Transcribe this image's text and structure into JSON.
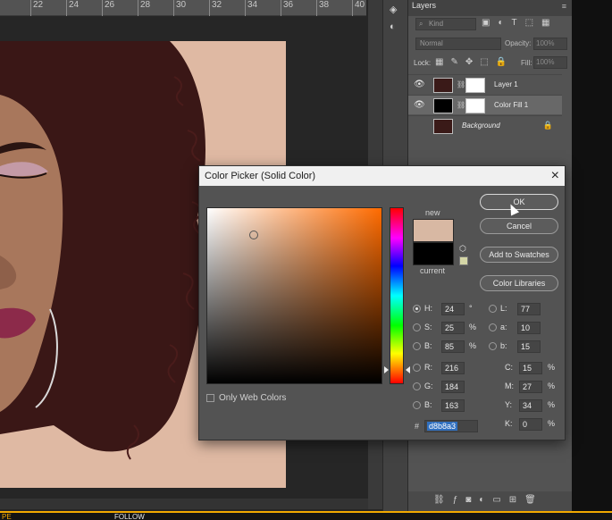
{
  "ruler": {
    "ticks": [
      "22",
      "24",
      "26",
      "28",
      "30",
      "32",
      "34",
      "36",
      "38",
      "40"
    ]
  },
  "layers_panel": {
    "tab": "Layers",
    "kind_placeholder": "Kind",
    "blend_mode": "Normal",
    "opacity_label": "Opacity:",
    "opacity_value": "100%",
    "lock_label": "Lock:",
    "fill_label": "Fill:",
    "fill_value": "100%",
    "layers": [
      {
        "name": "Layer 1",
        "visible": true,
        "selected": false
      },
      {
        "name": "Color Fill 1",
        "visible": true,
        "selected": true
      },
      {
        "name": "Background",
        "visible": false,
        "selected": false,
        "locked": true
      }
    ]
  },
  "dialog": {
    "title": "Color Picker (Solid Color)",
    "new_label": "new",
    "current_label": "current",
    "only_web_colors": "Only Web Colors",
    "buttons": {
      "ok": "OK",
      "cancel": "Cancel",
      "add_to_swatches": "Add to Swatches",
      "color_libraries": "Color Libraries"
    },
    "hsb": {
      "h": {
        "label": "H:",
        "value": "24",
        "unit": "°",
        "selected": true
      },
      "s": {
        "label": "S:",
        "value": "25",
        "unit": "%"
      },
      "b": {
        "label": "B:",
        "value": "85",
        "unit": "%"
      }
    },
    "rgb": {
      "r": {
        "label": "R:",
        "value": "216"
      },
      "g": {
        "label": "G:",
        "value": "184"
      },
      "b": {
        "label": "B:",
        "value": "163"
      }
    },
    "lab": {
      "l": {
        "label": "L:",
        "value": "77"
      },
      "a": {
        "label": "a:",
        "value": "10"
      },
      "b": {
        "label": "b:",
        "value": "15"
      }
    },
    "cmyk": {
      "c": {
        "label": "C:",
        "value": "15",
        "unit": "%"
      },
      "m": {
        "label": "M:",
        "value": "27",
        "unit": "%"
      },
      "y": {
        "label": "Y:",
        "value": "34",
        "unit": "%"
      },
      "k": {
        "label": "K:",
        "value": "0",
        "unit": "%"
      }
    },
    "hex_label": "#",
    "hex_value": "d8b8a3",
    "new_color": "#d8b8a3",
    "current_color": "#000000"
  },
  "taskbar": {
    "left": "PE",
    "follow": "FOLLOW"
  },
  "colors": {
    "accent": "#f2a900",
    "background_fill": "#dfb9a3"
  }
}
